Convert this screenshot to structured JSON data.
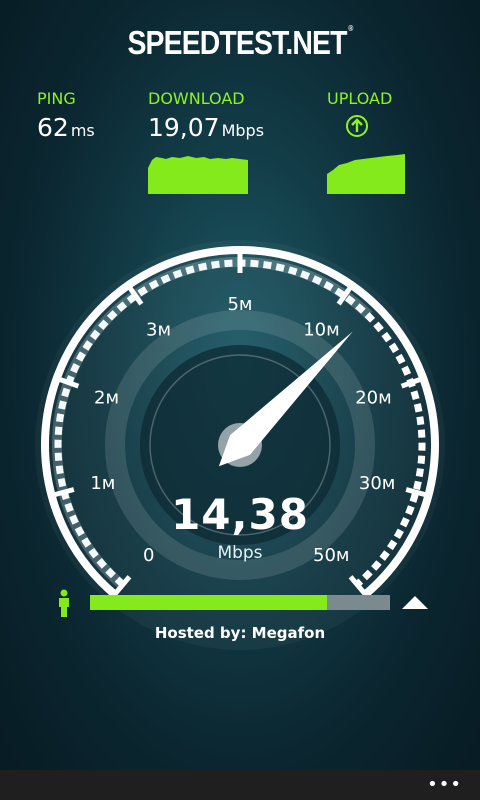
{
  "app": {
    "title": "SPEEDTEST.NET",
    "trademark": "®"
  },
  "stats": {
    "ping": {
      "label": "PING",
      "value": "62",
      "unit": "ms"
    },
    "download": {
      "label": "DOWNLOAD",
      "value": "19,07",
      "unit": "Mbps"
    },
    "upload": {
      "label": "UPLOAD",
      "icon": "arrow-up-circle-icon"
    }
  },
  "gauge": {
    "scale_labels": [
      "0",
      "1м",
      "2м",
      "3м",
      "5м",
      "10м",
      "20м",
      "30м",
      "50м"
    ],
    "current_value": "14,38",
    "unit": "Mbps",
    "needle_fraction": 0.66
  },
  "progress": {
    "fraction": 0.79,
    "start_icon": "person-icon",
    "end_icon": "server-icon"
  },
  "host": {
    "text": "Hosted by: Megafon"
  },
  "appbar": {
    "more_label": "•••"
  },
  "colors": {
    "accent": "#8ff12a",
    "bar_fill": "#84ea1c",
    "bar_track": "#7b8a8f"
  }
}
